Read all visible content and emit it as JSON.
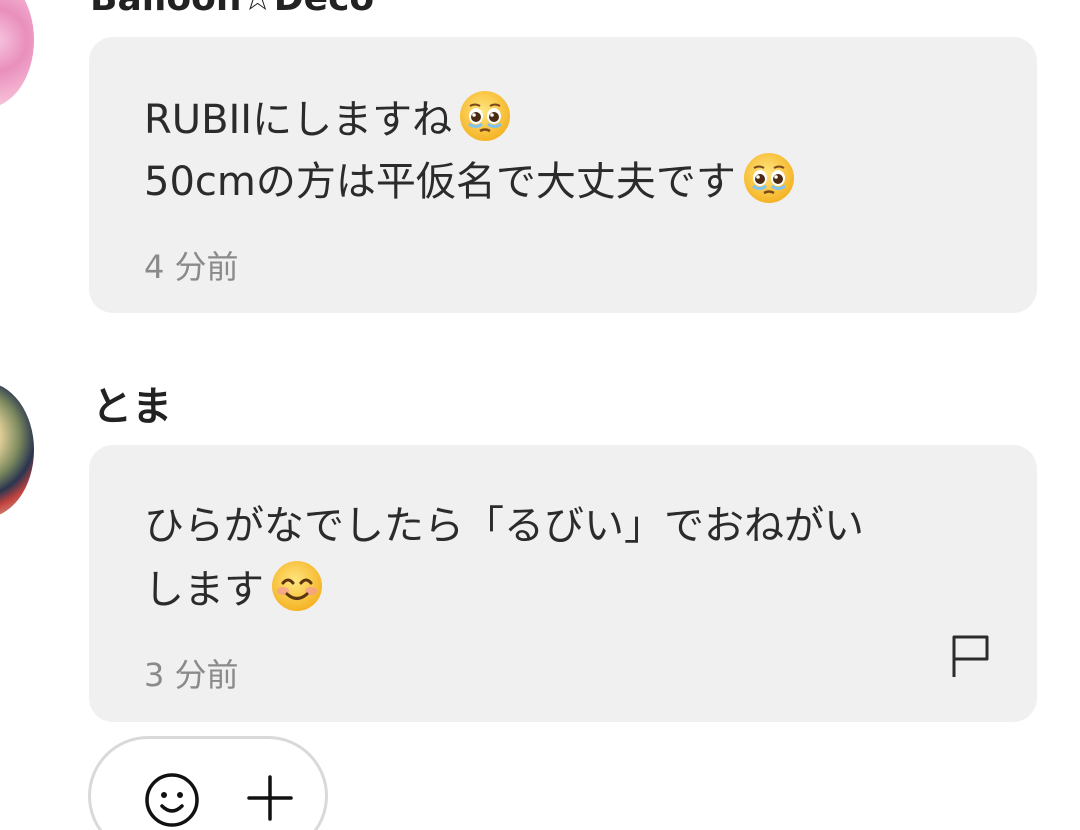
{
  "comments": [
    {
      "author": "Balloon☆Deco",
      "lines": [
        "RUBIIにしますね",
        "50cmの方は平仮名で大丈夫です"
      ],
      "line_emojis": [
        "pleading-face-icon",
        "pleading-face-icon"
      ],
      "time": "4 分前"
    },
    {
      "author": "とま",
      "lines": [
        "ひらがなでしたら「るびい」でおねがい",
        "します"
      ],
      "line_emojis": [
        null,
        "smiling-face-icon"
      ],
      "time": "3 分前",
      "has_report_flag": true
    }
  ],
  "reaction_bar": {
    "icons": [
      "smile-icon",
      "plus-icon"
    ]
  },
  "colors": {
    "bubble_bg": "#f0f0f0",
    "text": "#2b2b2b",
    "timestamp": "#8a8a8a",
    "border": "#d9d9d9"
  }
}
